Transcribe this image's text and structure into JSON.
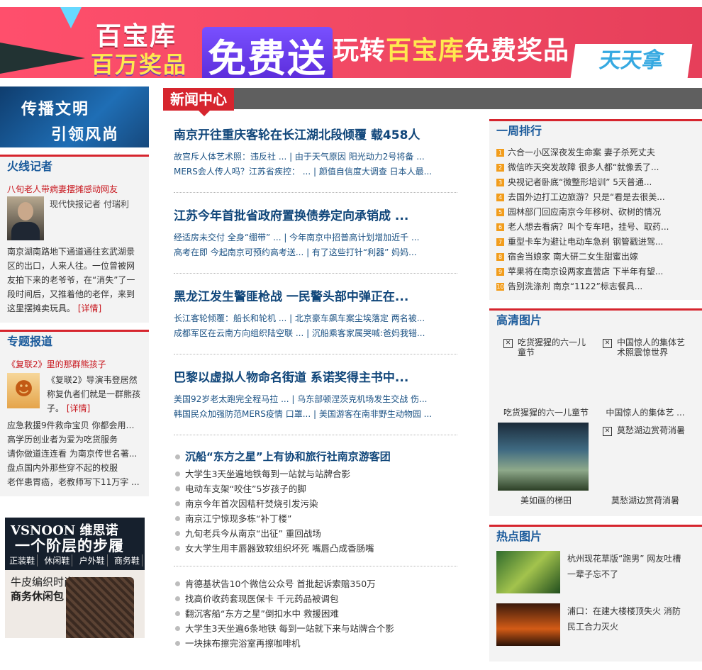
{
  "banner": {
    "line1": "百宝库",
    "line2": "百万奖品",
    "big": "免费送",
    "slogan_a": "玩转",
    "slogan_b": "百宝库",
    "slogan_c": "免费奖品",
    "badge": "天天拿"
  },
  "promo": {
    "line1": "传播文明",
    "line2": "引领风尚"
  },
  "hot_reporter": {
    "title": "火线记者",
    "headline": "八旬老人带病妻摆摊感动网友",
    "reporter": "现代快报记者 付瑞利",
    "body": "南京湖南路地下通道通往玄武湖景区的出口，人来人往。一位曾被网友拍下来的老爷爷，在“消失”了一段时间后，又推着他的老伴，来到这里摆摊卖玩具。",
    "more": "[详情]"
  },
  "special": {
    "title": "专题报道",
    "headline": "《复联2》里的那群熊孩子",
    "body": "《复联2》导演韦登居然称复仇者们就是一群熊孩子。",
    "more": "[详情]",
    "items": [
      "应急救援9件救命宝贝 你都会用吗？",
      "高学历创业者为爱为吃货服务",
      "请你做道连连看 为南京传世名著...",
      "盘点国内外那些穿不起的校服",
      "老伴患胃癌，老教师写下11万字 ..."
    ]
  },
  "ad": {
    "brand": "VSNOON 维思诺",
    "slogan": "一个阶层的步履",
    "cats": [
      "正装鞋",
      "休闲鞋",
      "户外鞋",
      "商务鞋"
    ],
    "line1": "牛皮编织时尚",
    "line2": "商务休闲包"
  },
  "news_center": {
    "title": "新闻中心",
    "blocks": [
      {
        "headline": "南京开往重庆客轮在长江湖北段倾覆 载458人",
        "sub1": "故宫斥人体艺术照：违反社 ... | 由于天气原因 阳光动力2号将备 ...",
        "sub2": "MERS会人传人吗？江苏省疾控： ... | 颜值自信度大调查 日本人最..."
      },
      {
        "headline": "江苏今年首批省政府置换债券定向承销成 ...",
        "sub1": "经适房未交付 全身“绷带” ... | 今年南京中招普高计划增加近千 ...",
        "sub2": "高考在即 今起南京可预约高考送... | 有了这些打针“利器” 妈妈..."
      },
      {
        "headline": "黑龙江发生警匪枪战 一民警头部中弹正在...",
        "sub1": "长江客轮倾覆：船长和轮机 ... | 北京豪车飙车案尘埃落定 两名被...",
        "sub2": "成都军区在云南方向组织陆空联 ... | 沉船乘客家属哭喊:爸妈我错..."
      },
      {
        "headline": "巴黎以虚拟人物命名街道 系诺奖得主书中...",
        "sub1": "美国92岁老太跑完全程马拉 ... | 乌东部顿涅茨克机场发生交战 伤...",
        "sub2": "韩国民众加强防范MERS疫情 口罩... | 美国游客在南非野生动物园 ..."
      }
    ],
    "list1_lead": "沉船“东方之星”上有协和旅行社南京游客团",
    "list1": [
      "大学生3天坐遍地铁每到一站就与站牌合影",
      "电动车支架“咬住”5岁孩子的脚",
      "南京今年首次因秸秆焚烧引发污染",
      "南京江宁惊现多栋“补丁楼”",
      "九旬老兵今从南京“出征” 重回战场",
      "女大学生用丰唇器致软组织坏死 嘴唇凸成香肠嘴"
    ],
    "list2": [
      "肯德基状告10个微信公众号 首批起诉索赔350万",
      "找高价收药套现医保卡 千元药品被调包",
      "翻沉客船“东方之星”倒扣水中 救援困难",
      "大学生3天坐遍6条地铁 每到一站就下来与站牌合个影",
      "一块抹布擦完浴室再擦咖啡机"
    ]
  },
  "weekly_rank": {
    "title": "一周排行",
    "items": [
      "六合一小区深夜发生命案 妻子杀死丈夫",
      "微信昨天突发故障 很多人都“就像丢了...",
      "央视记者卧底“微整形培训” 5天普通...",
      "去国外边打工边旅游？只是“看是去很美...",
      "园林部门回应南京今年移树、砍树的情况",
      "老人想去看病？叫个专车吧，挂号、取药...",
      "重型卡车为避让电动车急刹 钢管戳进驾...",
      "宿舍当娘家 南大研二女生甜蜜出嫁",
      "苹果将在南京设两家直营店 下半年有望...",
      "告别洗涤剂 南京“1122”标志餐具..."
    ]
  },
  "hd_pics": {
    "title": "高清图片",
    "items": [
      {
        "alt": "吃货猩猩的六一儿童节",
        "caption": "吃货猩猩的六一儿童节"
      },
      {
        "alt": "中国惊人的集体艺术照震惊世界",
        "caption": "中国惊人的集体艺 ..."
      },
      {
        "alt": "",
        "caption": "美如画的梯田"
      },
      {
        "alt": "莫愁湖边赏荷消暑",
        "caption": "莫愁湖边赏荷消暑"
      }
    ]
  },
  "hot_pics": {
    "title": "热点图片",
    "items": [
      "杭州现花草版“跑男” 网友吐槽一辈子忘不了",
      "浦口：在建大楼楼顶失火 消防民工合力灭火"
    ]
  }
}
